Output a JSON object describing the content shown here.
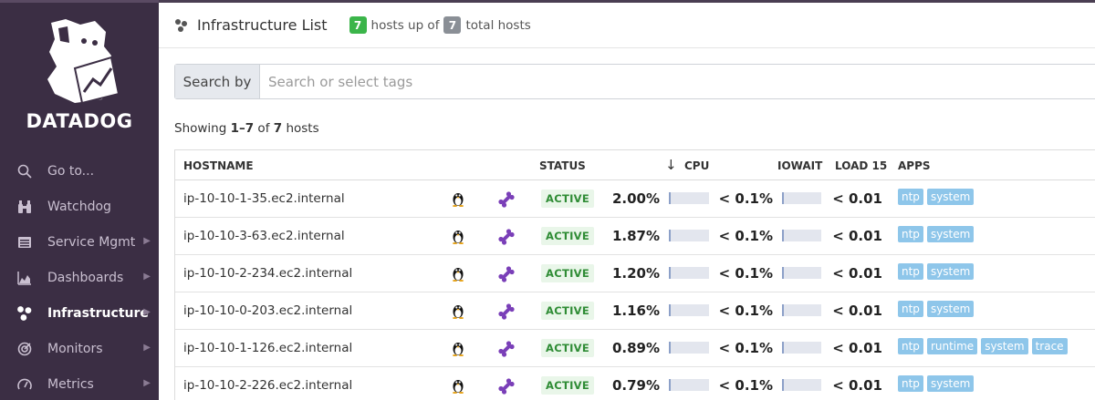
{
  "brand": {
    "name": "DATADOG"
  },
  "nav": [
    {
      "label": "Go to...",
      "icon": "search-icon",
      "chevron": false,
      "active": false
    },
    {
      "label": "Watchdog",
      "icon": "binoculars-icon",
      "chevron": false,
      "active": false
    },
    {
      "label": "Service Mgmt",
      "icon": "service-icon",
      "chevron": true,
      "active": false
    },
    {
      "label": "Dashboards",
      "icon": "dashboard-icon",
      "chevron": true,
      "active": false
    },
    {
      "label": "Infrastructure",
      "icon": "infrastructure-icon",
      "chevron": true,
      "active": true
    },
    {
      "label": "Monitors",
      "icon": "monitor-icon",
      "chevron": true,
      "active": false
    },
    {
      "label": "Metrics",
      "icon": "gauge-icon",
      "chevron": true,
      "active": false
    }
  ],
  "header": {
    "title": "Infrastructure List",
    "hosts_up_count": "7",
    "hosts_up_text": "hosts up of",
    "total_count": "7",
    "total_text": "total hosts"
  },
  "search": {
    "label": "Search by",
    "placeholder": "Search or select tags",
    "value": ""
  },
  "showing": {
    "prefix": "Showing ",
    "range": "1–7",
    "of": " of ",
    "total": "7",
    "suffix": " hosts"
  },
  "table": {
    "columns": {
      "hostname": "HOSTNAME",
      "status": "STATUS",
      "sort_arrow": "↓",
      "cpu": "CPU",
      "iowait": "IOWAIT",
      "load15": "LOAD 15",
      "apps": "APPS"
    },
    "rows": [
      {
        "hostname": "ip-10-10-1-35.ec2.internal",
        "status": "ACTIVE",
        "cpu": "2.00%",
        "iowait": "< 0.1%",
        "load15": "< 0.01",
        "apps": [
          "ntp",
          "system"
        ]
      },
      {
        "hostname": "ip-10-10-3-63.ec2.internal",
        "status": "ACTIVE",
        "cpu": "1.87%",
        "iowait": "< 0.1%",
        "load15": "< 0.01",
        "apps": [
          "ntp",
          "system"
        ]
      },
      {
        "hostname": "ip-10-10-2-234.ec2.internal",
        "status": "ACTIVE",
        "cpu": "1.20%",
        "iowait": "< 0.1%",
        "load15": "< 0.01",
        "apps": [
          "ntp",
          "system"
        ]
      },
      {
        "hostname": "ip-10-10-0-203.ec2.internal",
        "status": "ACTIVE",
        "cpu": "1.16%",
        "iowait": "< 0.1%",
        "load15": "< 0.01",
        "apps": [
          "ntp",
          "system"
        ]
      },
      {
        "hostname": "ip-10-10-1-126.ec2.internal",
        "status": "ACTIVE",
        "cpu": "0.89%",
        "iowait": "< 0.1%",
        "load15": "< 0.01",
        "apps": [
          "ntp",
          "runtime",
          "system",
          "trace"
        ]
      },
      {
        "hostname": "ip-10-10-2-226.ec2.internal",
        "status": "ACTIVE",
        "cpu": "0.79%",
        "iowait": "< 0.1%",
        "load15": "< 0.01",
        "apps": [
          "ntp",
          "system"
        ]
      }
    ]
  },
  "colors": {
    "sidebar_bg": "#3b2e44",
    "active_green": "#3bb54a",
    "tag_blue": "#8ec6ea",
    "agent_purple": "#7a3fb8"
  }
}
